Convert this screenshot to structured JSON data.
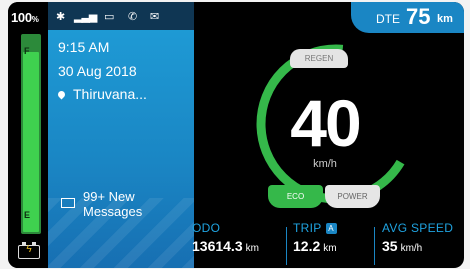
{
  "fuel": {
    "percent": "100",
    "percent_unit": "%",
    "full_mark": "F",
    "empty_mark": "E",
    "level": 0.92
  },
  "status": {
    "icons": [
      "bluetooth-icon",
      "signal-icon",
      "battery-status-icon",
      "phone-icon",
      "mail-icon"
    ]
  },
  "info": {
    "time": "9:15 AM",
    "date": "30 Aug 2018",
    "location": "Thiruvana...",
    "messages_line1": "99+ New",
    "messages_line2": "Messages"
  },
  "dte": {
    "label": "DTE",
    "value": "75",
    "unit": "km"
  },
  "gauge": {
    "speed": "40",
    "unit": "km/h",
    "regen_label": "REGEN",
    "eco_label": "ECO",
    "power_label": "POWER",
    "ring_color": "#35b84a"
  },
  "stats": {
    "odo_label": "ODO",
    "odo_value": "13614.3",
    "odo_unit": "km",
    "trip_label": "TRIP",
    "trip_badge": "A",
    "trip_value": "12.2",
    "trip_unit": "km",
    "avg_label": "AVG SPEED",
    "avg_value": "35",
    "avg_unit": "km/h"
  },
  "colors": {
    "accent": "#1a86c4",
    "eco": "#35b84a",
    "background": "#000000"
  }
}
